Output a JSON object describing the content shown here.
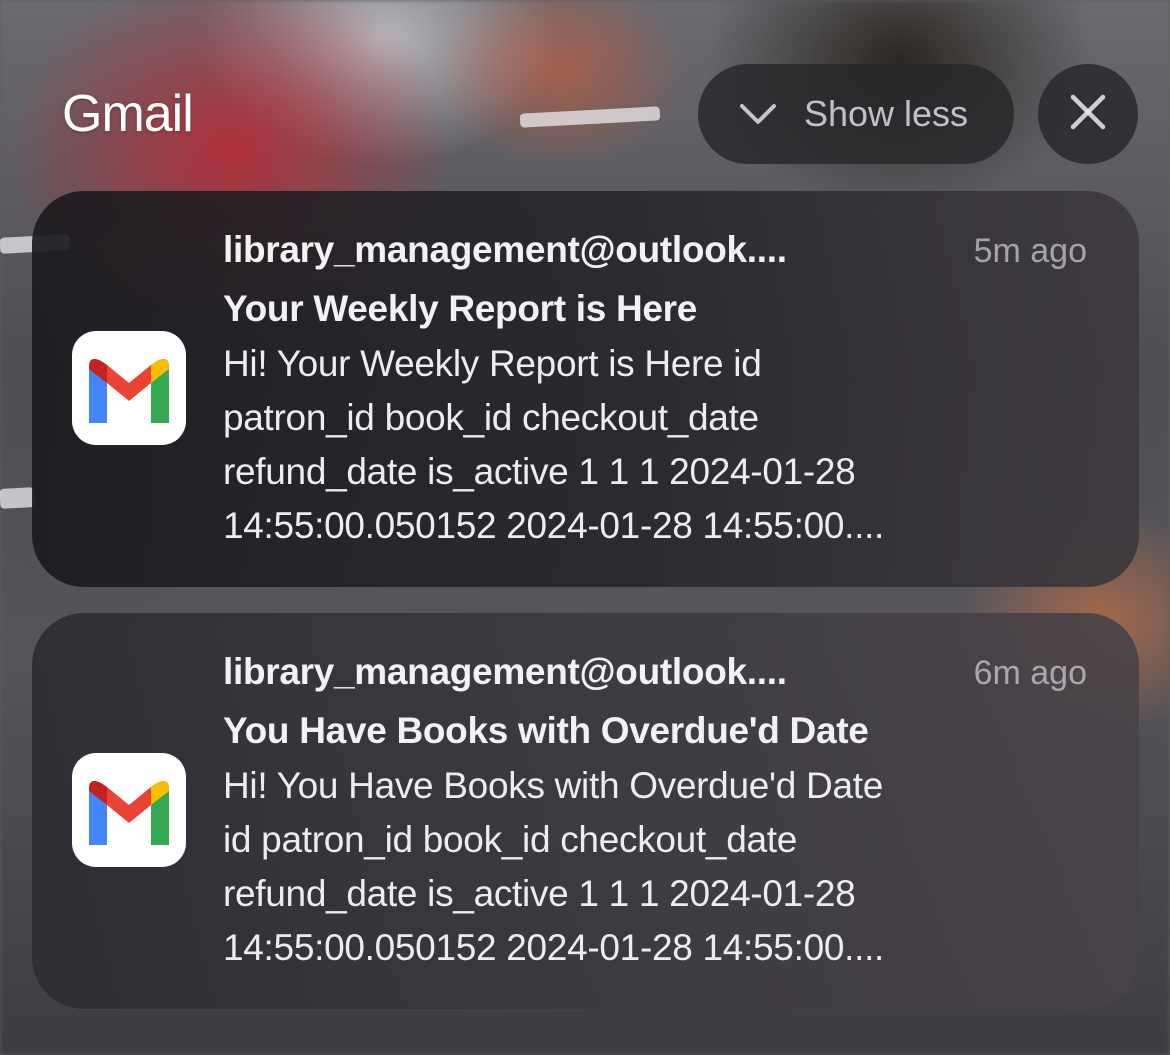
{
  "header": {
    "app_name": "Gmail",
    "show_less_label": "Show less",
    "chevron_icon": "chevron-down-icon",
    "close_icon": "close-icon"
  },
  "colors": {
    "card_text": "#f2f2f4",
    "timestamp": "#a5a5aa",
    "gmail_red": "#ea4335",
    "gmail_blue": "#4285f4",
    "gmail_green": "#34a853",
    "gmail_yellow": "#fbbc04"
  },
  "notifications": [
    {
      "sender": "library_management@outlook....",
      "time": "5m ago",
      "subject": "Your Weekly Report is Here",
      "body_lines": [
        "Hi! Your Weekly Report is Here id",
        "patron_id book_id checkout_date",
        "refund_date is_active 1 1 1 2024-01-28",
        "14:55:00.050152 2024-01-28 14:55:00...."
      ],
      "icon": "gmail-icon"
    },
    {
      "sender": "library_management@outlook....",
      "time": "6m ago",
      "subject": "You Have Books with Overdue'd Date",
      "body_lines": [
        "Hi! You Have Books with Overdue'd Date",
        "id patron_id book_id checkout_date",
        "refund_date is_active 1 1 1 2024-01-28",
        "14:55:00.050152 2024-01-28 14:55:00...."
      ],
      "icon": "gmail-icon"
    }
  ]
}
